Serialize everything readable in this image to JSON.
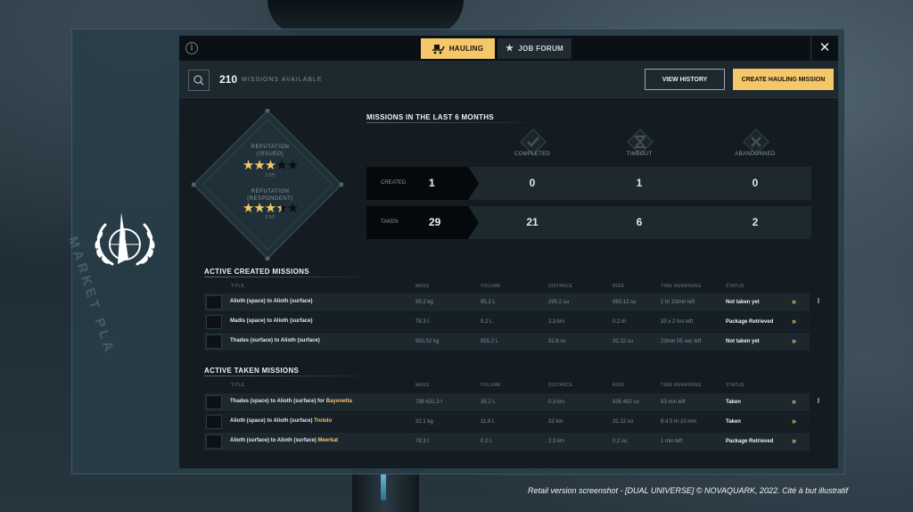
{
  "tabs": [
    {
      "label": "HAULING",
      "icon": "cube-cart-icon",
      "active": true
    },
    {
      "label": "JOB FORUM",
      "icon": "star-icon",
      "active": false
    }
  ],
  "header": {
    "missions_count": "210",
    "missions_label": "MISSIONS AVAILABLE",
    "view_history": "VIEW HISTORY",
    "create_mission": "CREATE HAULING MISSION"
  },
  "reputation": {
    "issued_label": "REPUTATION\n(ISSUED)",
    "issued_score": "3.2/5",
    "issued_stars": 3,
    "respondent_label": "REPUTATION\n(RESPONDENT)",
    "respondent_score": "3.5/5",
    "respondent_stars": 3.5
  },
  "stats": {
    "title": "MISSIONS IN THE LAST 6 MONTHS",
    "columns": [
      "COMPLETED",
      "TIMEOUT",
      "ABANDONNED"
    ],
    "rows": [
      {
        "label": "CREATED",
        "total": "1",
        "values": [
          "0",
          "1",
          "0"
        ]
      },
      {
        "label": "TAKEN",
        "total": "29",
        "values": [
          "21",
          "6",
          "2"
        ]
      }
    ]
  },
  "columns": [
    "TITLE",
    "MASS",
    "VOLUME",
    "DISTANCE",
    "RIDE",
    "TIME REMAINING",
    "STATUS"
  ],
  "created_missions": {
    "title": "ACTIVE CREATED MISSIONS",
    "rows": [
      {
        "title": "Alioth (space) to Alioth (surface)",
        "who": "",
        "mass": "95.2 kg",
        "volume": "95.2 L",
        "distance": "295.2 su",
        "ride": "963.12 su",
        "time": "1 hr 23min left",
        "status": "Not taken yet"
      },
      {
        "title": "Madis (space) to Alioth (surface)",
        "who": "",
        "mass": "78.3 t",
        "volume": "0.2 L",
        "distance": "2.3 km",
        "ride": "0.2 m",
        "time": "33 x 2 hrs left",
        "status": "Package Retrieved"
      },
      {
        "title": "Thades (surface) to Alioth (surface)",
        "who": "",
        "mass": "950.52 kg",
        "volume": "855.2 L",
        "distance": "32.6 su",
        "ride": "32.12 su",
        "time": "23min 55 sec left",
        "status": "Not taken yet"
      }
    ]
  },
  "taken_missions": {
    "title": "ACTIVE TAKEN MISSIONS",
    "rows": [
      {
        "title": "Thades (space) to Alioth (surface) for",
        "who": "Bayonetta",
        "mass": "798 631.3 t",
        "volume": "35.2 L",
        "distance": "0.3 km",
        "ride": "935 452 su",
        "time": "53 min left",
        "status": "Taken"
      },
      {
        "title": "Alioth (space) to Alioth (surface)",
        "who": "Trololo",
        "mass": "32.1 kg",
        "volume": "11.9 L",
        "distance": "32 km",
        "ride": "32.12 su",
        "time": "8 d 5 hr 10 min",
        "status": "Taken"
      },
      {
        "title": "Alioth (surface) to Alioth (surface)",
        "who": "Meerkat",
        "mass": "78.3 t",
        "volume": "0.2 L",
        "distance": "2.3 km",
        "ride": "0.2 su",
        "time": "1 min left",
        "status": "Package Retrieved"
      }
    ]
  },
  "side_label": "MARKET PLA",
  "caption": "Retail version screenshot -  [DUAL UNIVERSE]  © NOVAQUARK,  2022. Cité à but illustratif",
  "colors": {
    "accent": "#f4c76a",
    "panel": "#141c22",
    "row": "#1c272e"
  }
}
